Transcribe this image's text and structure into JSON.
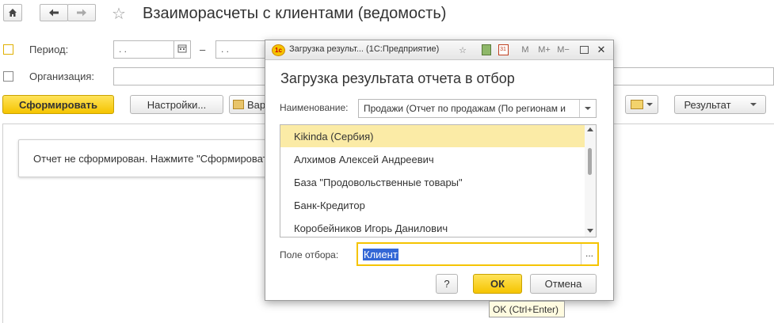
{
  "header": {
    "title": "Взаиморасчеты с клиентами (ведомость)",
    "home_icon": "home-icon",
    "back_icon": "arrow-left-icon",
    "forward_icon": "arrow-right-icon",
    "favorite_icon": "star-icon"
  },
  "filters": {
    "period_label": "Период:",
    "period_from": " .  .",
    "period_dash": "–",
    "period_to": " .  .",
    "organization_label": "Организация:"
  },
  "toolbar": {
    "generate_label": "Сформировать",
    "settings_label": "Настройки...",
    "variant_label": "Вар",
    "result_label": "Результат"
  },
  "report": {
    "message": "Отчет не сформирован. Нажмите \"Сформировать\""
  },
  "dialog": {
    "window_title": "Загрузка результ...  (1С:Предприятие)",
    "heading": "Загрузка результата отчета в отбор",
    "name_label": "Наименование:",
    "name_value": "Продажи (Отчет по продажам (По регионам и",
    "items": [
      "Kikinda (Сербия)",
      "Алхимов Алексей Андреевич",
      "База \"Продовольственные товары\"",
      "Банк-Кредитор",
      "Коробейников Игорь Данилович"
    ],
    "selected_index": 0,
    "filter_field_label": "Поле отбора:",
    "filter_field_value": "Клиент",
    "help_label": "?",
    "ok_label": "ОК",
    "cancel_label": "Отмена",
    "toolbar_m": "M",
    "toolbar_mplus": "M+",
    "toolbar_mminus": "M−",
    "ellipsis": "..."
  },
  "tooltip": {
    "text": "OK (Ctrl+Enter)"
  },
  "colors": {
    "accent_yellow": "#f5c400",
    "selection": "#fbeba6",
    "highlight_text_bg": "#3367d6"
  }
}
